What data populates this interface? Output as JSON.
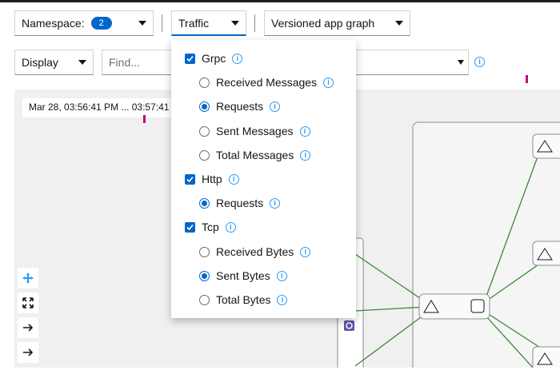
{
  "toolbar": {
    "namespace_label": "Namespace:",
    "namespace_count": "2",
    "traffic_label": "Traffic",
    "graph_type_label": "Versioned app graph",
    "display_label": "Display",
    "find_placeholder": "Find..."
  },
  "graph": {
    "timestamp": "Mar 28, 03:56:41 PM ... 03:57:41 PM"
  },
  "traffic_menu": {
    "groups": [
      {
        "label": "Grpc",
        "checked": true,
        "options": [
          {
            "label": "Received Messages",
            "selected": false
          },
          {
            "label": "Requests",
            "selected": true
          },
          {
            "label": "Sent Messages",
            "selected": false
          },
          {
            "label": "Total Messages",
            "selected": false
          }
        ]
      },
      {
        "label": "Http",
        "checked": true,
        "options": [
          {
            "label": "Requests",
            "selected": true
          }
        ]
      },
      {
        "label": "Tcp",
        "checked": true,
        "options": [
          {
            "label": "Received Bytes",
            "selected": false
          },
          {
            "label": "Sent Bytes",
            "selected": true
          },
          {
            "label": "Total Bytes",
            "selected": false
          }
        ]
      }
    ]
  },
  "colors": {
    "accent": "#0066cc",
    "info": "#2b9af3",
    "edge": "#3e8635",
    "marker": "#c0007a"
  },
  "icons": {
    "info": "info-circle-icon",
    "caret": "caret-down-icon",
    "pan": "arrows-move-icon",
    "fit": "expand-icon",
    "layout": "arrow-right-icon"
  }
}
